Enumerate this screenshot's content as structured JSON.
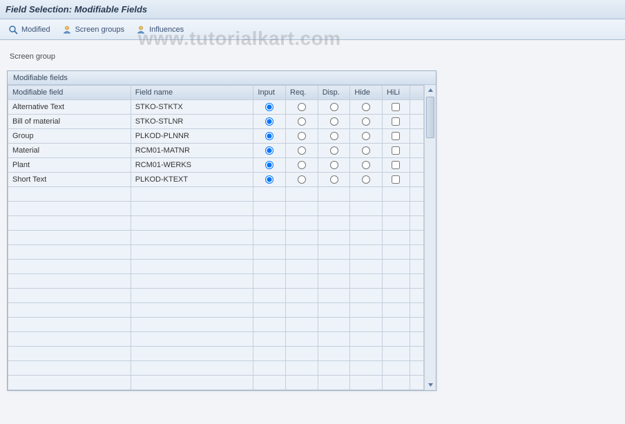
{
  "title": "Field Selection: Modifiable Fields",
  "toolbar": {
    "modified": "Modified",
    "screen_groups": "Screen groups",
    "influences": "Influences"
  },
  "screen_group_label": "Screen group",
  "panel_title": "Modifiable fields",
  "columns": {
    "modifiable_field": "Modifiable field",
    "field_name": "Field name",
    "input": "Input",
    "req": "Req.",
    "disp": "Disp.",
    "hide": "Hide",
    "hili": "HiLi"
  },
  "rows": [
    {
      "modifiable": "Alternative Text",
      "field_name": "STKO-STKTX",
      "sel": "input",
      "hili": false
    },
    {
      "modifiable": "Bill of material",
      "field_name": "STKO-STLNR",
      "sel": "input",
      "hili": false
    },
    {
      "modifiable": "Group",
      "field_name": "PLKOD-PLNNR",
      "sel": "input",
      "hili": false
    },
    {
      "modifiable": "Material",
      "field_name": "RCM01-MATNR",
      "sel": "input",
      "hili": false
    },
    {
      "modifiable": "Plant",
      "field_name": "RCM01-WERKS",
      "sel": "input",
      "hili": false
    },
    {
      "modifiable": "Short Text",
      "field_name": "PLKOD-KTEXT",
      "sel": "input",
      "hili": false
    }
  ],
  "empty_rows": 14,
  "watermark": "www.tutorialkart.com"
}
